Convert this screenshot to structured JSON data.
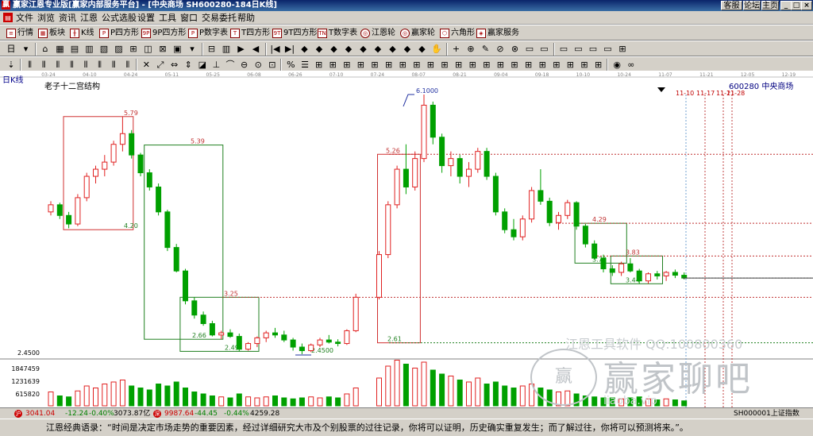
{
  "window": {
    "title": "赢家江恩专业版[赢家内部服务平台] - [中央商场  SH600280-184日K线]",
    "links": [
      "客服",
      "论坛",
      "主页"
    ],
    "controls": [
      "_",
      "□",
      "×"
    ]
  },
  "menu": [
    "文件",
    "浏览",
    "资讯",
    "江恩",
    "公式选股",
    "设置",
    "工具",
    "窗口",
    "交易委托",
    "帮助"
  ],
  "toolbar1": [
    {
      "icon": "list-icon",
      "label": "行情"
    },
    {
      "icon": "blocks-icon",
      "label": "板块"
    },
    {
      "icon": "candle-icon",
      "label": "K线"
    },
    {
      "icon": "P",
      "label": "P四方形"
    },
    {
      "icon": "9P",
      "label": "9P四方形"
    },
    {
      "icon": "P",
      "label": "P数字表"
    },
    {
      "icon": "T",
      "label": "T四方形"
    },
    {
      "icon": "9T",
      "label": "9T四方形"
    },
    {
      "icon": "TN",
      "label": "T数字表"
    },
    {
      "icon": "wheel-icon",
      "label": "江恩轮"
    },
    {
      "icon": "wheel-icon",
      "label": "赢家轮"
    },
    {
      "icon": "hexagon-icon",
      "label": "六角形"
    },
    {
      "icon": "service-icon",
      "label": "赢家服务"
    }
  ],
  "toolbar2_glyphs": [
    "日",
    "▾",
    "⌂",
    "▦",
    "▤",
    "▥",
    "▧",
    "▨",
    "⊞",
    "◫",
    "⊠",
    "▣",
    "▾",
    "⊟",
    "▥",
    "▶",
    "◀",
    "|◀",
    "▶|",
    "◆",
    "◆",
    "◆",
    "◆",
    "◆",
    "◆",
    "◆",
    "◆",
    "◆",
    "✋",
    "+",
    "⊕",
    "✎",
    "⊘",
    "⊗",
    "▭",
    "▭",
    "▭",
    "▭",
    "▭",
    "▭",
    "⊞"
  ],
  "toolbar3_glyphs": [
    "⇣",
    "⫴",
    "⫴",
    "⫴",
    "⫴",
    "⫴",
    "⫴",
    "⫴",
    "⫴",
    "✕",
    "⤢",
    "⇔",
    "⇕",
    "◪",
    "⊥",
    "⌒",
    "⊖",
    "⊙",
    "⊡",
    "%",
    "☰",
    "⊞",
    "⊞",
    "⊞",
    "⊞",
    "⊞",
    "⊞",
    "⊞",
    "⊞",
    "⊞",
    "⊞",
    "⊞",
    "⊞",
    "⊞",
    "⊞",
    "⊞",
    "⊞",
    "⊞",
    "⊞",
    "⊞",
    "⊞",
    "⊞",
    "◉",
    "∞"
  ],
  "chart": {
    "period": "日K线",
    "indicator": "老子十二宫结构",
    "stock_code": "600280",
    "stock_name": "中央商场",
    "date_ticks": [
      "03-24",
      "04-10",
      "04-24",
      "05-11",
      "05-25",
      "06-08",
      "06-26",
      "07-10",
      "07-24",
      "08-07",
      "08-21",
      "09-04",
      "09-18",
      "10-10",
      "10-24",
      "11-07",
      "11-21",
      "12-05",
      "12-19"
    ],
    "projection_labels": [
      "11-10",
      "11-17",
      "11-21",
      "11-28"
    ],
    "volume_ticks": [
      "1847459",
      "1231639",
      "615820"
    ],
    "left_price": "2.4500",
    "watermark": "江恩工具软件    QQ:100800360",
    "logo_mark": "赢",
    "logo_text": "赢家聊吧",
    "logo_sub": "iiaoba.vip"
  },
  "chart_data": {
    "type": "candlestick",
    "title": "中央商场 600280 日K线 — 老子十二宫结构",
    "x_range": [
      "03-24",
      "12-19"
    ],
    "y_range": [
      2.45,
      6.1
    ],
    "candles_ohlc": [
      [
        4.45,
        4.6,
        4.4,
        4.55
      ],
      [
        4.55,
        4.58,
        4.35,
        4.4
      ],
      [
        4.4,
        4.45,
        4.22,
        4.28
      ],
      [
        4.28,
        4.7,
        4.25,
        4.65
      ],
      [
        4.65,
        5.0,
        4.6,
        4.95
      ],
      [
        4.95,
        5.1,
        4.85,
        5.05
      ],
      [
        5.05,
        5.25,
        4.95,
        5.15
      ],
      [
        5.15,
        5.45,
        5.1,
        5.4
      ],
      [
        5.4,
        5.79,
        5.3,
        5.55
      ],
      [
        5.55,
        5.6,
        5.2,
        5.25
      ],
      [
        5.25,
        5.28,
        4.95,
        5.0
      ],
      [
        5.0,
        5.05,
        4.75,
        4.8
      ],
      [
        4.8,
        4.85,
        4.4,
        4.45
      ],
      [
        4.45,
        4.48,
        3.9,
        3.95
      ],
      [
        3.95,
        4.0,
        3.6,
        3.62
      ],
      [
        3.62,
        3.65,
        3.15,
        3.2
      ],
      [
        3.2,
        3.25,
        2.95,
        3.0
      ],
      [
        3.0,
        3.05,
        2.85,
        2.88
      ],
      [
        2.88,
        2.92,
        2.7,
        2.72
      ],
      [
        2.72,
        2.78,
        2.66,
        2.75
      ],
      [
        2.75,
        2.8,
        2.68,
        2.7
      ],
      [
        2.7,
        2.74,
        2.49,
        2.52
      ],
      [
        2.52,
        2.62,
        2.5,
        2.6
      ],
      [
        2.6,
        2.7,
        2.55,
        2.68
      ],
      [
        2.68,
        2.78,
        2.62,
        2.75
      ],
      [
        2.75,
        2.82,
        2.68,
        2.72
      ],
      [
        2.72,
        2.78,
        2.62,
        2.65
      ],
      [
        2.65,
        2.68,
        2.5,
        2.55
      ],
      [
        2.55,
        2.6,
        2.45,
        2.5
      ],
      [
        2.5,
        2.6,
        2.48,
        2.58
      ],
      [
        2.58,
        2.68,
        2.55,
        2.65
      ],
      [
        2.65,
        2.72,
        2.6,
        2.62
      ],
      [
        2.62,
        2.66,
        2.56,
        2.6
      ],
      [
        2.6,
        2.8,
        2.58,
        2.78
      ],
      [
        2.78,
        3.3,
        2.76,
        3.25
      ],
      [
        3.25,
        3.9,
        3.22,
        3.85
      ],
      [
        3.85,
        4.6,
        3.8,
        4.55
      ],
      [
        4.55,
        5.1,
        4.5,
        5.05
      ],
      [
        5.05,
        5.4,
        4.7,
        4.8
      ],
      [
        4.8,
        5.3,
        4.75,
        5.2
      ],
      [
        5.2,
        6.1,
        5.15,
        5.95
      ],
      [
        5.95,
        6.0,
        5.4,
        5.5
      ],
      [
        5.5,
        5.55,
        5.0,
        5.1
      ],
      [
        5.1,
        5.3,
        4.95,
        5.2
      ],
      [
        5.2,
        5.25,
        4.85,
        4.95
      ],
      [
        4.95,
        5.15,
        4.8,
        5.05
      ],
      [
        5.05,
        5.35,
        5.0,
        5.3
      ],
      [
        5.3,
        5.35,
        4.9,
        4.95
      ],
      [
        4.95,
        5.0,
        4.4,
        4.45
      ],
      [
        4.45,
        4.5,
        4.15,
        4.2
      ],
      [
        4.2,
        4.35,
        4.05,
        4.1
      ],
      [
        4.1,
        4.4,
        4.05,
        4.35
      ],
      [
        4.35,
        4.8,
        4.3,
        4.75
      ],
      [
        4.75,
        5.05,
        4.55,
        4.6
      ],
      [
        4.6,
        4.65,
        4.25,
        4.3
      ],
      [
        4.3,
        4.45,
        4.2,
        4.4
      ],
      [
        4.4,
        4.62,
        4.35,
        4.58
      ],
      [
        4.58,
        4.6,
        4.2,
        4.25
      ],
      [
        4.25,
        4.28,
        3.95,
        4.0
      ],
      [
        4.0,
        4.05,
        3.78,
        3.8
      ],
      [
        3.8,
        3.85,
        3.6,
        3.65
      ],
      [
        3.65,
        3.7,
        3.55,
        3.6
      ],
      [
        3.6,
        3.75,
        3.55,
        3.72
      ],
      [
        3.72,
        3.8,
        3.6,
        3.62
      ],
      [
        3.62,
        3.65,
        3.44,
        3.48
      ],
      [
        3.48,
        3.6,
        3.44,
        3.58
      ],
      [
        3.58,
        3.62,
        3.5,
        3.55
      ],
      [
        3.55,
        3.62,
        3.48,
        3.6
      ],
      [
        3.6,
        3.64,
        3.52,
        3.56
      ],
      [
        3.56,
        3.6,
        3.5,
        3.52
      ]
    ],
    "gann_levels": [
      {
        "label": "5.79",
        "value": 5.79
      },
      {
        "label": "5.39",
        "value": 5.39
      },
      {
        "label": "4.20",
        "value": 4.2
      },
      {
        "label": "3.25",
        "value": 3.25
      },
      {
        "label": "2.66",
        "value": 2.66
      },
      {
        "label": "2.49",
        "value": 2.49
      },
      {
        "label": "2.4500",
        "value": 2.45
      },
      {
        "label": "5.26",
        "value": 5.26
      },
      {
        "label": "6.1000",
        "value": 6.1
      },
      {
        "label": "2.61",
        "value": 2.61
      },
      {
        "label": "4.29",
        "value": 4.29
      },
      {
        "label": "3.83",
        "value": 3.83
      },
      {
        "label": "3.73",
        "value": 3.73
      },
      {
        "label": "3.44",
        "value": 3.44
      }
    ],
    "volume": [
      14,
      10,
      9,
      15,
      20,
      18,
      22,
      24,
      26,
      20,
      18,
      16,
      22,
      20,
      24,
      18,
      14,
      12,
      10,
      9,
      8,
      12,
      9,
      8,
      9,
      10,
      8,
      7,
      8,
      9,
      8,
      9,
      8,
      12,
      18,
      28,
      40,
      46,
      42,
      38,
      44,
      36,
      32,
      30,
      26,
      24,
      28,
      22,
      24,
      20,
      18,
      20,
      22,
      18,
      16,
      14,
      15,
      12,
      10,
      9,
      8,
      8,
      7,
      8,
      9,
      7,
      6,
      7,
      6,
      5
    ],
    "grid": false,
    "legend": "none"
  },
  "statusbar": {
    "index1_value": "3041.04",
    "index1_change": "-12.24",
    "index1_pct": "-0.40%",
    "index1_amount": "3073.87亿",
    "index2_value": "9987.64",
    "index2_change": "-44.45",
    "index2_pct": "-0.44%",
    "index2_amount": "4259.28",
    "right_code": "SH000001上证指数"
  },
  "quote": "江恩经典语录：“时间是决定市场走势的重要因素，经过详细研究大市及个别股票的过往记录，你将可以证明，历史确实重复发生；而了解过往，你将可以预测将来。”。"
}
